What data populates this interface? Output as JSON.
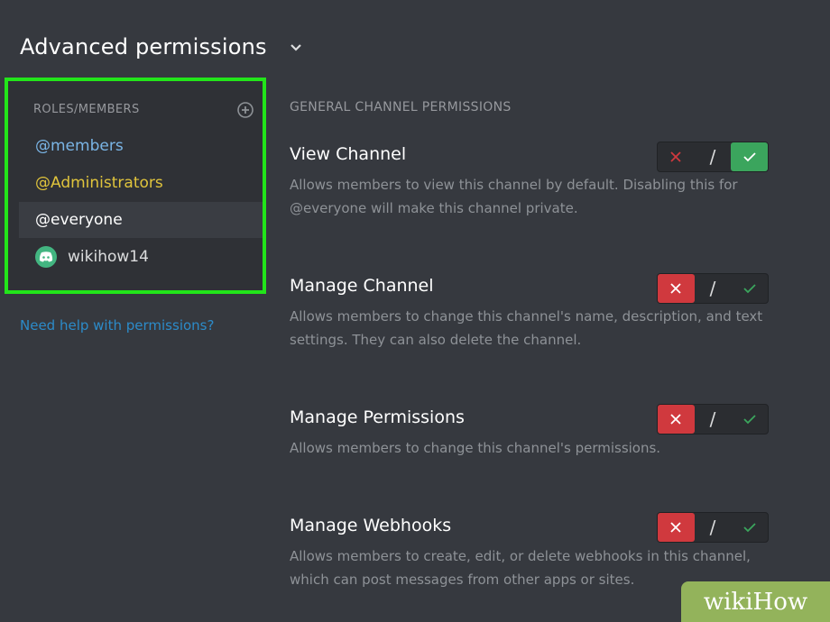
{
  "header": {
    "title": "Advanced permissions",
    "expand_icon": "chevron-down-icon"
  },
  "roles": {
    "header": "ROLES/MEMBERS",
    "add_icon": "add-circle-icon",
    "items": [
      {
        "label": "@members",
        "color": "#7ab5e6"
      },
      {
        "label": "@Administrators",
        "color": "#e0c43c"
      },
      {
        "label": "@everyone",
        "color": "#ffffff",
        "selected": true
      },
      {
        "label": "wikihow14",
        "color": "#dcddde",
        "icon": "discord-avatar-icon"
      }
    ],
    "help_link": "Need help with permissions?"
  },
  "section_title": "GENERAL CHANNEL PERMISSIONS",
  "permissions": [
    {
      "name": "View Channel",
      "description": "Allows members to view this channel by default. Disabling this for @everyone will make this channel private.",
      "state": "allow"
    },
    {
      "name": "Manage Channel",
      "description": "Allows members to change this channel's name, description, and text settings. They can also delete the channel.",
      "state": "deny"
    },
    {
      "name": "Manage Permissions",
      "description": "Allows members to change this channel's permissions.",
      "state": "deny"
    },
    {
      "name": "Manage Webhooks",
      "description": "Allows members to create, edit, or delete webhooks in this channel, which can post messages from other apps or sites.",
      "state": "deny"
    }
  ],
  "toggle": {
    "deny_icon": "x-icon",
    "separator": "/",
    "allow_icon": "check-icon"
  },
  "colors": {
    "deny": "#d0393e",
    "allow": "#3ba55d",
    "highlight": "#22e51a"
  },
  "watermark": "wikiHow"
}
